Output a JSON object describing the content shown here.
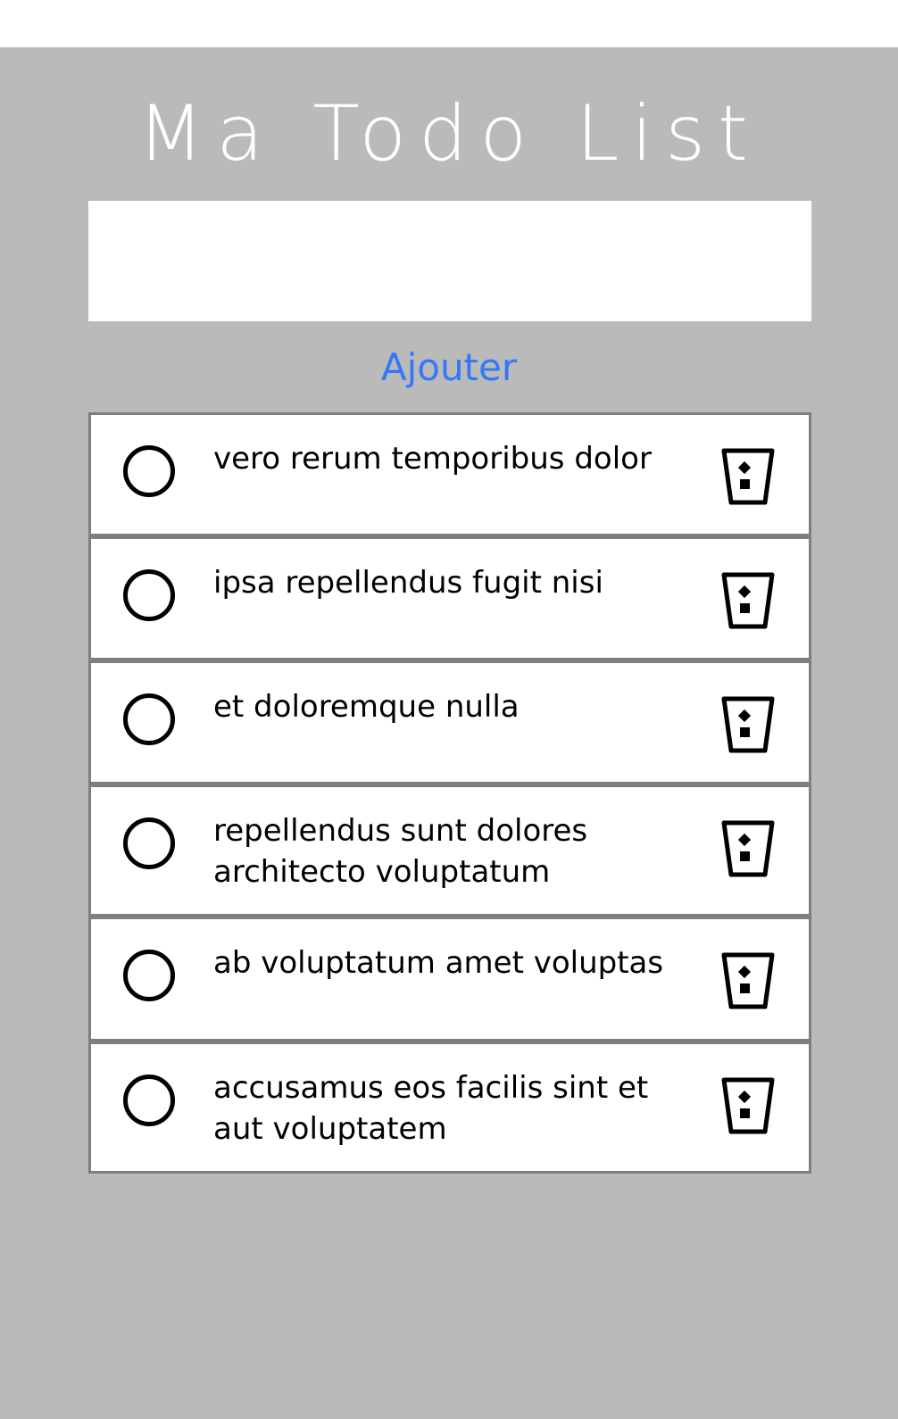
{
  "app": {
    "title": "Ma Todo List",
    "input_value": "",
    "add_button_label": "Ajouter"
  },
  "colors": {
    "background": "#bababa",
    "accent": "#3478f6",
    "item_border": "#7e7e7e"
  },
  "todos": [
    {
      "text": "vero rerum temporibus dolor",
      "done": false,
      "check_icon": "circle-outline-icon",
      "delete_icon": "trash-icon"
    },
    {
      "text": "ipsa repellendus fugit nisi",
      "done": false,
      "check_icon": "circle-outline-icon",
      "delete_icon": "trash-icon"
    },
    {
      "text": "et doloremque nulla",
      "done": false,
      "check_icon": "circle-outline-icon",
      "delete_icon": "trash-icon"
    },
    {
      "text": "repellendus sunt dolores architecto voluptatum",
      "done": false,
      "check_icon": "circle-outline-icon",
      "delete_icon": "trash-icon"
    },
    {
      "text": "ab voluptatum amet voluptas",
      "done": false,
      "check_icon": "circle-outline-icon",
      "delete_icon": "trash-icon"
    },
    {
      "text": "accusamus eos facilis sint et aut voluptatem",
      "done": false,
      "check_icon": "circle-outline-icon",
      "delete_icon": "trash-icon"
    }
  ]
}
